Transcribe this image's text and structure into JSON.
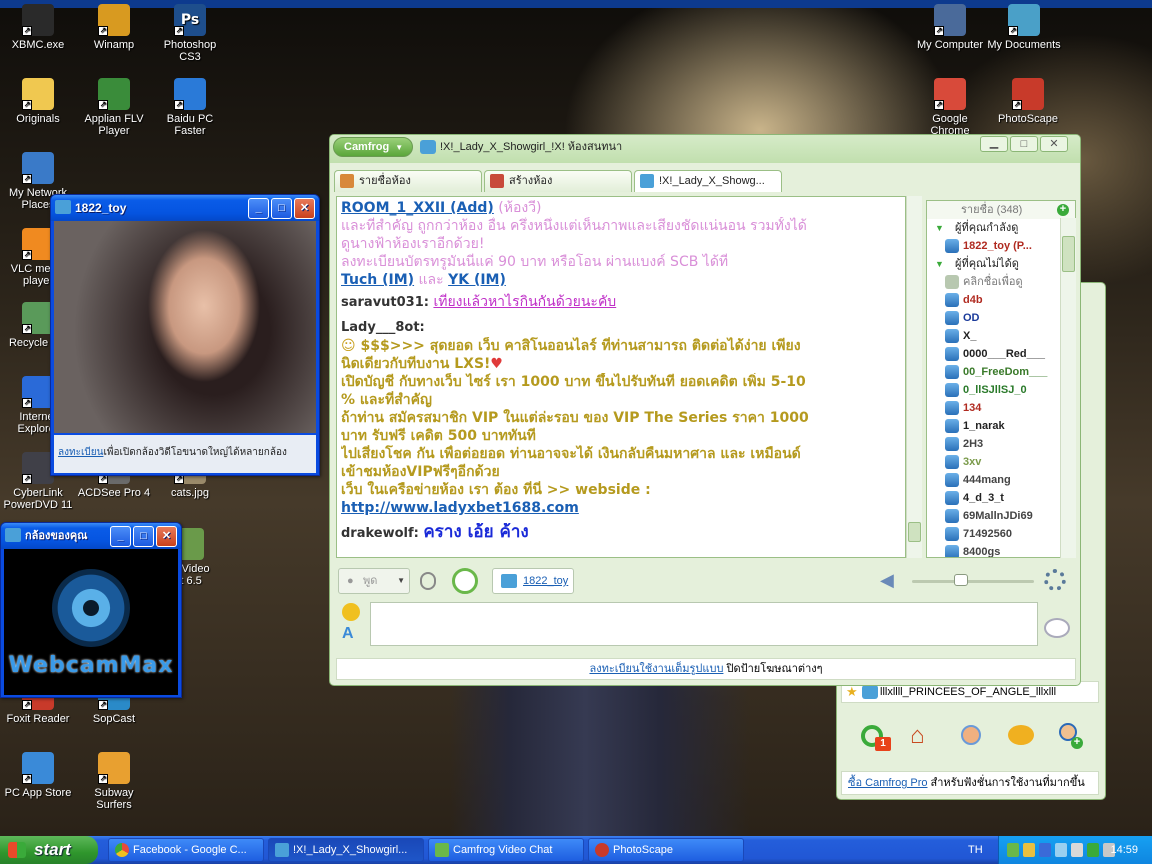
{
  "desktop": {
    "icons": [
      {
        "id": "xbmc",
        "label": "XBMC.exe",
        "c": "#2a2a2a"
      },
      {
        "id": "winamp",
        "label": "Winamp",
        "c": "#d89a20"
      },
      {
        "id": "photoshop",
        "label": "Photoshop CS3",
        "c": "#1e4e8c",
        "glyph": "Ps"
      },
      {
        "id": "mycomputer",
        "label": "My Computer",
        "c": "#4a6a9a"
      },
      {
        "id": "mydocuments",
        "label": "My Documents",
        "c": "#4aa0c8"
      },
      {
        "id": "originals",
        "label": "Originals",
        "c": "#f0c850"
      },
      {
        "id": "applian",
        "label": "Applian FLV Player",
        "c": "#3a8c3a"
      },
      {
        "id": "baidu",
        "label": "Baidu PC Faster",
        "c": "#2a7ad8"
      },
      {
        "id": "chrome",
        "label": "Google Chrome",
        "c": "#d84a3a"
      },
      {
        "id": "photoscape",
        "label": "PhotoScape",
        "c": "#c83a2a"
      },
      {
        "id": "mynetwork",
        "label": "My Network Places",
        "c": "#3a7ac8"
      },
      {
        "id": "vlc",
        "label": "VLC media player",
        "c": "#f08a20"
      },
      {
        "id": "recycle",
        "label": "Recycle Bin",
        "c": "#5a9a5a"
      },
      {
        "id": "ie",
        "label": "Internet Explorer",
        "c": "#2a6ad8"
      },
      {
        "id": "cyberlink",
        "label": "CyberLink PowerDVD 11",
        "c": "#404048"
      },
      {
        "id": "acdsee",
        "label": "ACDSee Pro 4",
        "c": "#6a6a6a"
      },
      {
        "id": "catsjpg",
        "label": "cats.jpg",
        "c": "#9a8a6a"
      },
      {
        "id": "foxit",
        "label": "Foxit Reader",
        "c": "#c83a2a"
      },
      {
        "id": "sopcast",
        "label": "SopCast",
        "c": "#2a8ac8"
      },
      {
        "id": "pcappstore",
        "label": "PC App Store",
        "c": "#3a8ad8"
      },
      {
        "id": "subway",
        "label": "Subway Surfers",
        "c": "#e8a030"
      },
      {
        "id": "camfrogvideo",
        "label": "og Video\nat 6.5",
        "c": "#6a9a4a"
      }
    ]
  },
  "video_window": {
    "title": "1822_toy",
    "register_link": "ลงทะเบียน",
    "register_rest": "เพื่อเปิดกล้องวิดีโอขนาดใหญ่ได้หลายกล้อง"
  },
  "webcam_window": {
    "title": "กล้องของคุณ",
    "logo_text": "WebcamMax"
  },
  "camfrog": {
    "menu_label": "Camfrog",
    "title": "!X!_Lady_X_Showgirl_!X! ห้องสนทนา",
    "tabs": [
      "รายชื่อห้อง",
      "สร้างห้อง",
      "!X!_Lady_X_Showg..."
    ],
    "chat": {
      "l1a": "ROOM_1_XXII (Add)",
      "l1b": " (ห้องวี)",
      "l2": "และที่สำคัญ ถูกกว่าห้อง อื่น ครึ่งหนึ่งแต่เห็นภาพและเสียงชัดแน่นอน รวมทั้งได้",
      "l3": "ดูนางฟ้าห้องเราอีกด้วย!",
      "l4": "ลงทะเบียนบัตรทรูมันนี่แค่   90   บาท หรือโอน ผ่านแบงค์ SCB ได้ที่",
      "l5a": "Tuch (IM)",
      "l5b": "  และ  ",
      "l5c": "YK (IM)",
      "s1_name": "saravut031:",
      "s1_msg": "เที่ยงแล้วหาไรกินกันด้วยนะคับ",
      "s2_name": "Lady___8ot:",
      "m1": "$$$>>> สุดยอด เว็บ คาสิโนออนไลร์ ที่ท่านสามารถ ติดต่อได้ง่าย เพียง",
      "m2": "นิดเดียวกับทีบงาน LXS!",
      "m3": "เปิดบัญชี กับทางเว็บ ไซร์ เรา 1000 บาท ขึ้นไปรับทันที ยอดเคดิต เพิ่ม 5-10",
      "m4": "% และที่สำคัญ",
      "m5": "ถ้าท่าน สมัครสมาชิก VIP ในแต่ล่ะรอบ ของ VIP The Series ราคา 1000",
      "m6": "บาท รับฟรี เคดิต 500 บาททันที",
      "m7": "ไปเสี่ยงโชค กัน เพื่อต่อยอด ท่านอาจจะได้ เงินกลับคืนมหาศาล และ เหมือนด์",
      "m8": "เข้าชมห้องVIPฟรีๆอีกด้วย",
      "m9": "เว็บ ในเครือข่ายห้อง เรา ต้อง ที่นี่  >> webside :",
      "m10": "http://www.ladyxbet1688.com",
      "s3_name": "drakewolf:",
      "s3_msg": "คราง เอ้ย ค้าง"
    },
    "userlist": {
      "header": "รายชื่อ (348)",
      "watching_group": "ผู้ที่คุณกำลังดู",
      "watching_user": "1822_toy (P...",
      "notwatching_group": "ผู้ที่คุณไม่ได้ดู",
      "click_hint": "คลิกชื่อเพื่อดู",
      "users": [
        {
          "name": "d4b",
          "color": "#b02a20"
        },
        {
          "name": "OD",
          "color": "#1a3a9a"
        },
        {
          "name": "X_",
          "color": "#222222"
        },
        {
          "name": "0000___Red___",
          "color": "#222222"
        },
        {
          "name": "00_FreeDom___",
          "color": "#3a7a2a"
        },
        {
          "name": "0_llSJllSJ_0",
          "color": "#2a7a2a"
        },
        {
          "name": "134",
          "color": "#b02a20"
        },
        {
          "name": "1_narak",
          "color": "#222222"
        },
        {
          "name": "2H3",
          "color": "#444444"
        },
        {
          "name": "3xv",
          "color": "#7a9a4a"
        },
        {
          "name": "444mang",
          "color": "#444444"
        },
        {
          "name": "4_d_3_t",
          "color": "#222222"
        },
        {
          "name": "69MallnJDi69",
          "color": "#444444"
        },
        {
          "name": "71492560",
          "color": "#444444"
        },
        {
          "name": "8400gs",
          "color": "#444444"
        }
      ]
    },
    "voice": {
      "talk_label": "พูด",
      "watch_user": "1822_toy"
    },
    "footer": {
      "link": "ลงทะเบียนใช้งานเต็มรูปแบบ",
      "rest": " ปิดป้ายโฆษณาต่างๆ"
    }
  },
  "camfrog_back": {
    "favorite_room": "lllxllll_PRINCEES_OF_ANGLE_lllxlll",
    "badge_count": "1",
    "pro_link": "ซื้อ Camfrog Pro",
    "pro_rest": " สำหรับฟังชั่นการใช้งานที่มากขึ้น"
  },
  "taskbar": {
    "start_label": "start",
    "buttons": [
      "Facebook - Google C...",
      "!X!_Lady_X_Showgirl...",
      "Camfrog Video Chat",
      "PhotoScape"
    ],
    "language": "TH",
    "clock": "14:59"
  }
}
